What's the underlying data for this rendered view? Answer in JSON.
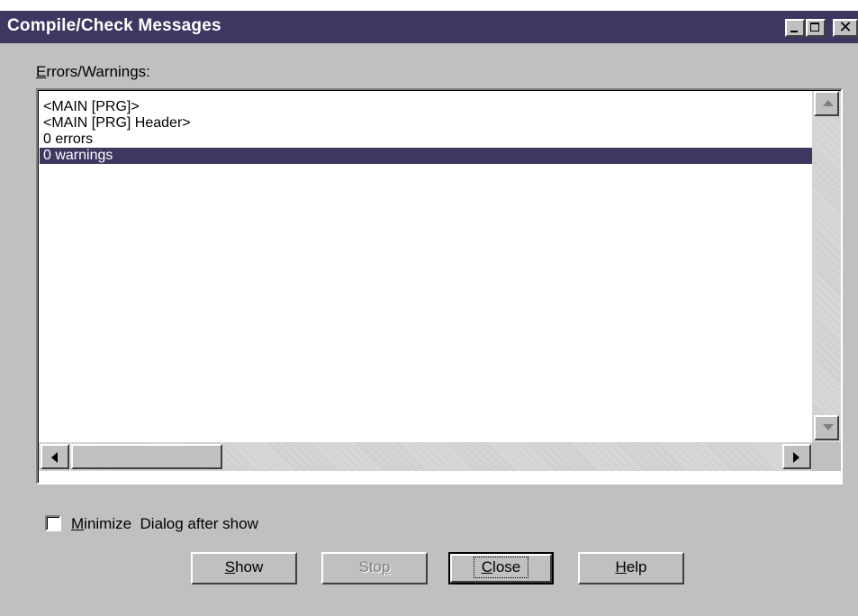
{
  "window": {
    "title": "Compile/Check Messages",
    "controls": [
      "minimize-icon",
      "maximize-icon",
      "close-icon"
    ],
    "close_glyph": "✕"
  },
  "errors_group": {
    "label_accel": "E",
    "label_rest": "rrors/Warnings:"
  },
  "messages": {
    "items": [
      "<MAIN [PRG]>",
      "<MAIN [PRG] Header>",
      "0 errors",
      "0 warnings"
    ],
    "selected_index": 3
  },
  "minimize_option": {
    "label_accel": "M",
    "label_rest": "inimize  Dialog after show",
    "checked": false
  },
  "buttons": {
    "show": {
      "accel": "S",
      "rest": "how"
    },
    "stop": {
      "pre": "Sto",
      "accel": "p",
      "disabled": true
    },
    "close": {
      "accel": "C",
      "rest": "lose",
      "default": true
    },
    "help": {
      "accel": "H",
      "rest": "elp"
    }
  },
  "colors": {
    "title_bar": "#3f3761",
    "selection": "#3f3761",
    "face": "#c0c0c0"
  }
}
